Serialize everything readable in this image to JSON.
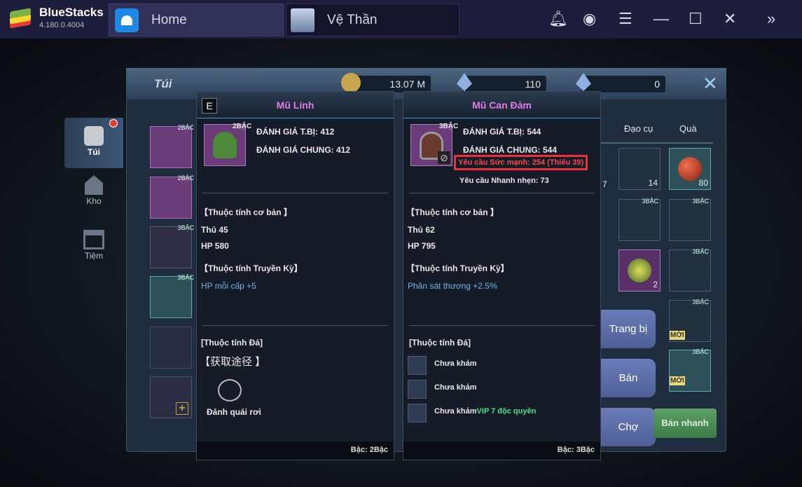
{
  "app": {
    "name": "BlueStacks",
    "version": "4.180.0.4004"
  },
  "tabs": [
    {
      "label": "Home"
    },
    {
      "label": "Vệ Thần"
    }
  ],
  "toolbar": {
    "icons": [
      "bell-icon",
      "account-icon",
      "menu-icon",
      "minimize-icon",
      "maximize-icon",
      "close-icon",
      "expand-icon"
    ]
  },
  "panel": {
    "title": "Túi",
    "currency": [
      {
        "icon": "coin-icon",
        "value": "13.07 M"
      },
      {
        "icon": "gem-lock-icon",
        "value": "110"
      },
      {
        "icon": "gem-icon",
        "value": "0"
      }
    ]
  },
  "side_tabs": [
    {
      "label": "Túi"
    },
    {
      "label": "Kho"
    },
    {
      "label": "Tiệm"
    }
  ],
  "inventory_list": [
    {
      "tier": "2BẬC"
    },
    {
      "tier": "2BẬC"
    },
    {
      "tier": "3BẬC"
    },
    {
      "tier": "3BẬC"
    }
  ],
  "grid_tabs": [
    "Đạo cụ",
    "Quà"
  ],
  "grid_counts": [
    "7",
    "14",
    "80",
    "2"
  ],
  "grid_tiers": [
    "3BẬC",
    "3BẬC",
    "3BẬC",
    "3BẬC",
    "3BẬC",
    "3BẬC",
    "3BẬC"
  ],
  "new_badge": "MỚI",
  "buttons": {
    "equip": "Trang bị",
    "sell": "Bán",
    "market": "Chợ",
    "quick_sell": "Bán nhanh"
  },
  "popup_left": {
    "badge": "E",
    "title": "Mũ Lính",
    "tier": "2BẬC",
    "score_item": "ĐÁNH GIÁ T.BỊ: 412",
    "score_total": "ĐÁNH GIÁ CHUNG: 412",
    "basic_header": "【Thuộc tính cơ bản 】",
    "basic": [
      "Thủ 45",
      "HP 580"
    ],
    "legend_header": "【Thuộc tính Truyền Kỳ】",
    "legend": "HP mỗi cấp   +5",
    "gem_header": "[Thuộc tính Đá]",
    "source": "【获取途径 】",
    "source_item": "Đánh quái rơi",
    "footer": "Bậc: 2Bậc"
  },
  "popup_right": {
    "title": "Mũ Can Đảm",
    "tier": "3BẬC",
    "score_item": "ĐÁNH GIÁ T.BỊ: 544",
    "score_total": "ĐÁNH GIÁ CHUNG: 544",
    "req_strength": "Yêu cầu Sức mạnh: 254 (Thiếu 39)",
    "req_agility": "Yêu cầu Nhanh nhẹn: 73",
    "basic_header": "【Thuộc tính cơ bản 】",
    "basic": [
      "Thủ 62",
      "HP 795"
    ],
    "legend_header": "【Thuộc tính Truyền Kỳ】",
    "legend": "Phản sát thương   +2.5%",
    "gem_header": "[Thuộc tính Đá]",
    "sockets": [
      "Chưa khảm",
      "Chưa khảm",
      "Chưa khảm"
    ],
    "vip": "VIP 7 độc quyền",
    "footer": "Bậc: 3Bậc"
  },
  "colors": {
    "highlight": "#e8313a",
    "title": "#e07ce8",
    "green": "#4fe08a"
  }
}
